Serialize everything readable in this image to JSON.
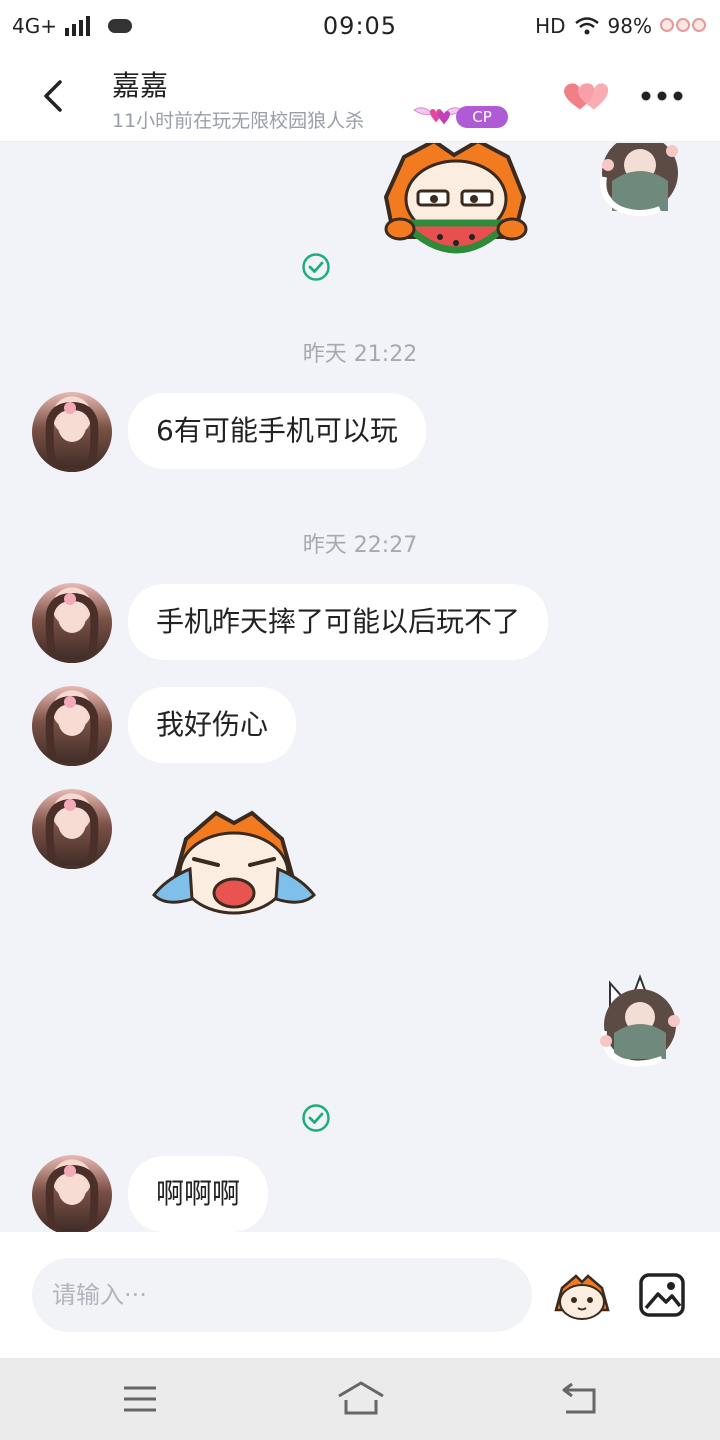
{
  "status_bar": {
    "network": "4G+",
    "time": "09:05",
    "hd": "HD",
    "battery": "98%"
  },
  "header": {
    "back_icon": "back-arrow-icon",
    "contact_name": "嘉嘉",
    "contact_status": "11小时前在玩无限校园狼人杀",
    "cp_label": "CP",
    "cp_color": "#b05bd6"
  },
  "messages": [
    {
      "type": "sticker",
      "from": "self",
      "sticker": "cat-eating-watermelon",
      "status": "sent"
    },
    {
      "type": "timestamp",
      "text": "昨天 21:22"
    },
    {
      "type": "text",
      "from": "other",
      "text": "6有可能手机可以玩"
    },
    {
      "type": "timestamp",
      "text": "昨天 22:27"
    },
    {
      "type": "text",
      "from": "other",
      "text": "手机昨天摔了可能以后玩不了"
    },
    {
      "type": "text",
      "from": "other",
      "text": "我好伤心"
    },
    {
      "type": "sticker",
      "from": "other",
      "sticker": "cat-crying"
    },
    {
      "type": "sticker",
      "from": "self",
      "sticker": "blank",
      "status": "sent"
    },
    {
      "type": "text",
      "from": "other",
      "text": "啊啊啊"
    }
  ],
  "input": {
    "placeholder": "请输入···"
  },
  "colors": {
    "background": "#f2f3f8",
    "sent_check": "#1fae7a",
    "bubble": "#ffffff"
  }
}
